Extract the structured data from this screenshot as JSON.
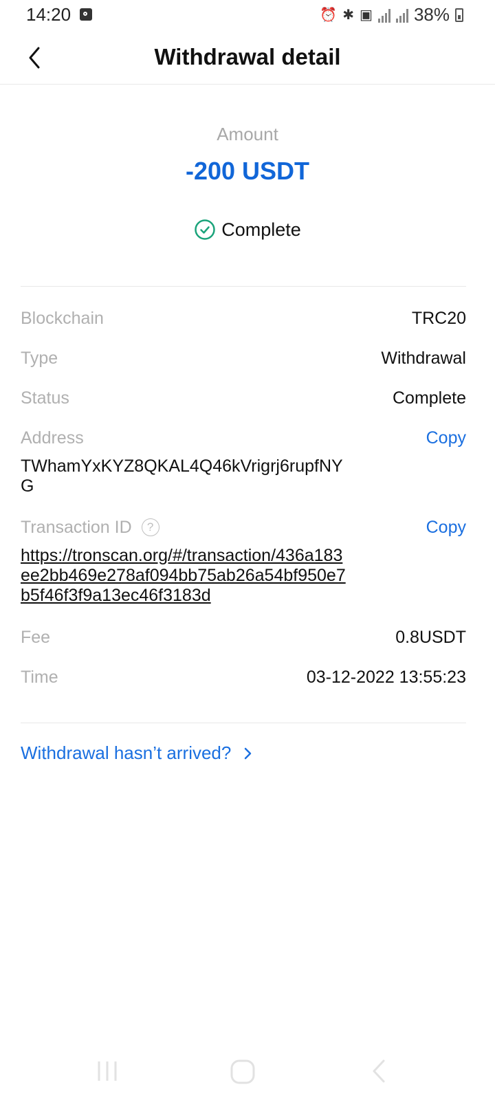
{
  "status_bar": {
    "time": "14:20",
    "battery": "38%",
    "icons": [
      "alarm-icon",
      "bluetooth-icon",
      "nfc-icon",
      "signal-icon",
      "battery-icon"
    ]
  },
  "header": {
    "title": "Withdrawal detail"
  },
  "summary": {
    "amount_label": "Amount",
    "amount_value": "-200 USDT",
    "status": "Complete",
    "accent_color": "#1166d8",
    "status_color": "#1aa37a"
  },
  "details": {
    "blockchain_label": "Blockchain",
    "blockchain_value": "TRC20",
    "type_label": "Type",
    "type_value": "Withdrawal",
    "status_label": "Status",
    "status_value": "Complete",
    "address_label": "Address",
    "address_copy": "Copy",
    "address_value": "TWhamYxKYZ8QKAL4Q46kVrigrj6rupfNYG",
    "txid_label": "Transaction ID",
    "txid_help": "?",
    "txid_copy": "Copy",
    "txid_value": "https://tronscan.org/#/transaction/436a183ee2bb469e278af094bb75ab26a54bf950e7b5f46f3f9a13ec46f3183d",
    "fee_label": "Fee",
    "fee_value": "0.8USDT",
    "time_label": "Time",
    "time_value": "03-12-2022 13:55:23"
  },
  "help": {
    "link_text": "Withdrawal hasn’t arrived?"
  }
}
